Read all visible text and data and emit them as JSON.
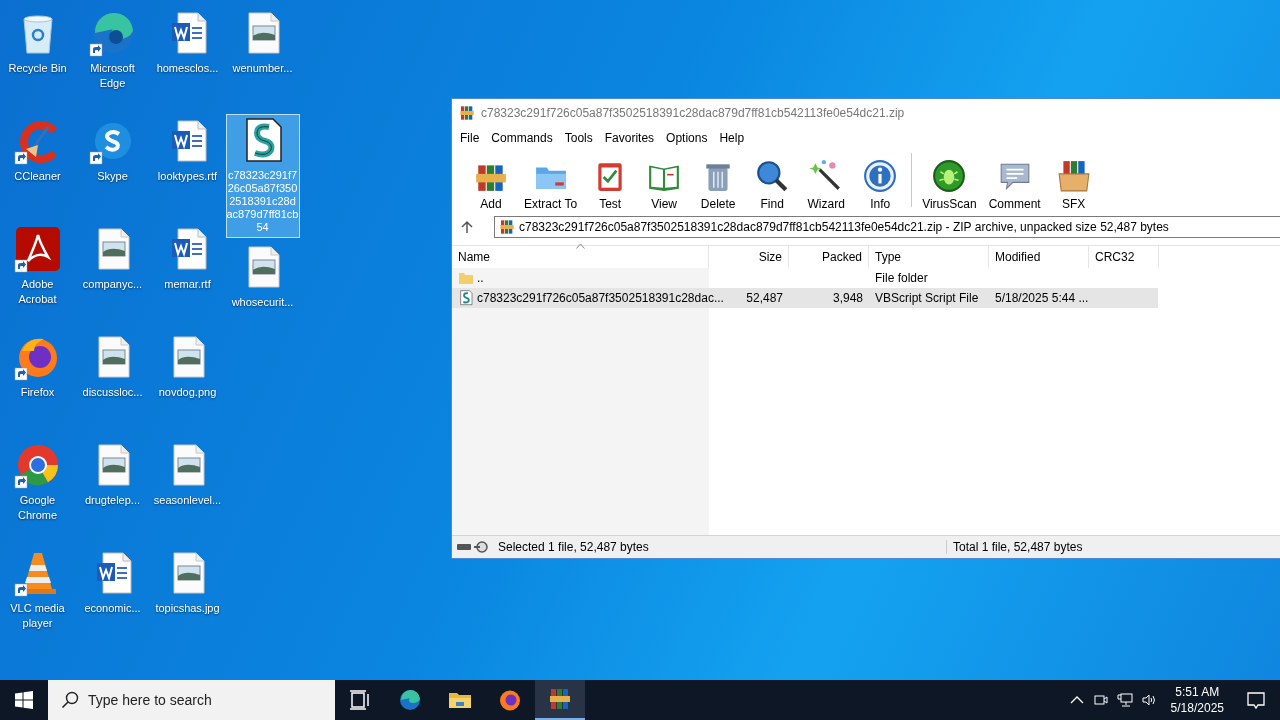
{
  "desktop": {
    "icons": [
      {
        "label": "Recycle Bin",
        "kind": "recycle",
        "shortcut": false,
        "selected": false
      },
      {
        "label": "CCleaner",
        "kind": "ccleaner",
        "shortcut": true,
        "selected": false
      },
      {
        "label": "Adobe Acrobat",
        "kind": "acrobat",
        "shortcut": true,
        "selected": false
      },
      {
        "label": "Firefox",
        "kind": "firefox",
        "shortcut": true,
        "selected": false
      },
      {
        "label": "Google Chrome",
        "kind": "chrome",
        "shortcut": true,
        "selected": false
      },
      {
        "label": "VLC media player",
        "kind": "vlc",
        "shortcut": true,
        "selected": false
      },
      {
        "label": "Microsoft Edge",
        "kind": "edge",
        "shortcut": true,
        "selected": false
      },
      {
        "label": "Skype",
        "kind": "skype",
        "shortcut": true,
        "selected": false
      },
      {
        "label": "companyc...",
        "kind": "image",
        "shortcut": false,
        "selected": false
      },
      {
        "label": "discussloc...",
        "kind": "image",
        "shortcut": false,
        "selected": false
      },
      {
        "label": "drugtelep...",
        "kind": "image",
        "shortcut": false,
        "selected": false
      },
      {
        "label": "economic...",
        "kind": "word",
        "shortcut": false,
        "selected": false
      },
      {
        "label": "homesclos...",
        "kind": "word",
        "shortcut": false,
        "selected": false
      },
      {
        "label": "looktypes.rtf",
        "kind": "word",
        "shortcut": false,
        "selected": false
      },
      {
        "label": "memar.rtf",
        "kind": "word",
        "shortcut": false,
        "selected": false
      },
      {
        "label": "novdog.png",
        "kind": "image",
        "shortcut": false,
        "selected": false
      },
      {
        "label": "seasonlevel...",
        "kind": "image",
        "shortcut": false,
        "selected": false
      },
      {
        "label": "topicshas.jpg",
        "kind": "image",
        "shortcut": false,
        "selected": false
      },
      {
        "label": "wenumber...",
        "kind": "image",
        "shortcut": false,
        "selected": false
      },
      {
        "label": "c78323c291f726c05a87f3502518391c28dac879d7ff81cb54",
        "kind": "script",
        "shortcut": false,
        "selected": true
      },
      {
        "label": "whosecurit...",
        "kind": "image",
        "shortcut": false,
        "selected": false
      }
    ]
  },
  "archiver": {
    "title": "c78323c291f726c05a87f3502518391c28dac879d7ff81cb542113fe0e54dc21.zip",
    "menu": [
      "File",
      "Commands",
      "Tools",
      "Favorites",
      "Options",
      "Help"
    ],
    "toolbar": [
      {
        "label": "Add",
        "kind": "add"
      },
      {
        "label": "Extract To",
        "kind": "extract"
      },
      {
        "label": "Test",
        "kind": "test"
      },
      {
        "label": "View",
        "kind": "view"
      },
      {
        "label": "Delete",
        "kind": "delete"
      },
      {
        "label": "Find",
        "kind": "find"
      },
      {
        "label": "Wizard",
        "kind": "wizard"
      },
      {
        "label": "Info",
        "kind": "info"
      },
      {
        "label": "VirusScan",
        "kind": "virusscan"
      },
      {
        "label": "Comment",
        "kind": "comment"
      },
      {
        "label": "SFX",
        "kind": "sfx"
      }
    ],
    "path": "c78323c291f726c05a87f3502518391c28dac879d7ff81cb542113fe0e54dc21.zip - ZIP archive, unpacked size 52,487 bytes",
    "columns": [
      "Name",
      "Size",
      "Packed",
      "Type",
      "Modified",
      "CRC32"
    ],
    "rows": [
      {
        "kind": "folder",
        "selected": false,
        "name": "..",
        "type": "File folder"
      },
      {
        "kind": "script",
        "selected": true,
        "name": "c78323c291f726c05a87f3502518391c28dac...",
        "size": "52,487",
        "packed": "3,948",
        "type": "VBScript Script File",
        "modified": "5/18/2025 5:44 ..."
      }
    ],
    "status": {
      "left": "Selected 1 file, 52,487 bytes",
      "right": "Total 1 file, 52,487 bytes"
    }
  },
  "taskbar": {
    "search_placeholder": "Type here to search",
    "apps": [
      {
        "kind": "taskview",
        "active": false
      },
      {
        "kind": "edge",
        "active": false
      },
      {
        "kind": "explorer",
        "active": false
      },
      {
        "kind": "firefox",
        "active": false
      },
      {
        "kind": "winrar",
        "active": true
      }
    ],
    "time": "5:51 AM",
    "date": "5/18/2025"
  }
}
